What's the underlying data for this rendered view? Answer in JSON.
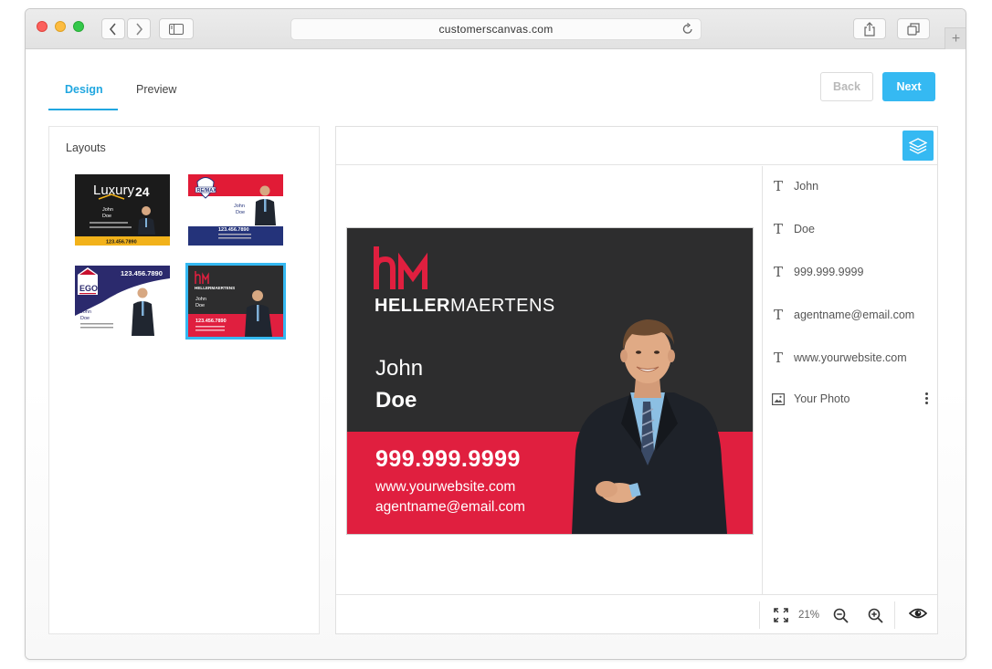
{
  "browser": {
    "url": "customerscanvas.com"
  },
  "tabs": [
    {
      "label": "Design",
      "active": true
    },
    {
      "label": "Preview",
      "active": false
    }
  ],
  "buttons": {
    "back": "Back",
    "next": "Next"
  },
  "layouts": {
    "title": "Layouts",
    "items": [
      {
        "name": "Luxury 24",
        "brand": "Luxury24",
        "first": "John",
        "last": "Doe",
        "phone": "123.456.7890",
        "selected": false
      },
      {
        "name": "RE/MAX",
        "brand": "RE/MAX",
        "first": "John",
        "last": "Doe",
        "phone": "123.456.7890",
        "selected": false
      },
      {
        "name": "EGO",
        "brand": "EGO",
        "first": "John",
        "last": "Doe",
        "phone": "123.456.7890",
        "selected": false
      },
      {
        "name": "Heller Maertens",
        "brand": "HELLERMAERTENS",
        "first": "John",
        "last": "Doe",
        "phone": "123.456.7890",
        "selected": true
      }
    ]
  },
  "card": {
    "logo_mark": "hm",
    "brand_bold": "HELLER",
    "brand_light": "MAERTENS",
    "first_name": "John",
    "last_name": "Doe",
    "phone": "999.999.9999",
    "website": "www.yourwebsite.com",
    "email": "agentname@email.com",
    "colors": {
      "dark": "#2d2d2e",
      "accent": "#e01f3f"
    }
  },
  "layers": [
    {
      "type": "text",
      "label": "John"
    },
    {
      "type": "text",
      "label": "Doe"
    },
    {
      "type": "text",
      "label": "999.999.9999"
    },
    {
      "type": "text",
      "label": "agentname@email.com"
    },
    {
      "type": "text",
      "label": "www.yourwebsite.com"
    },
    {
      "type": "image",
      "label": "Your Photo"
    }
  ],
  "zoom": {
    "level": "21%"
  },
  "colors": {
    "accent": "#35b9f2",
    "tab_active": "#21a7e0"
  }
}
